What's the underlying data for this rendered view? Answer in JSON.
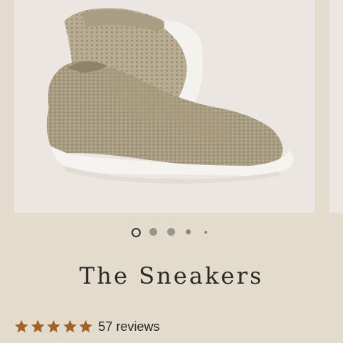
{
  "product": {
    "title": "The Sneakers",
    "image_alt": "sneakers-product-photo"
  },
  "carousel": {
    "total_slides": 5,
    "active_index": 0
  },
  "rating": {
    "stars": 5,
    "max_stars": 5,
    "reviews_text": "57 reviews"
  },
  "colors": {
    "background": "#e3dccc",
    "star": "#a0622a",
    "title": "#2c2a26"
  }
}
